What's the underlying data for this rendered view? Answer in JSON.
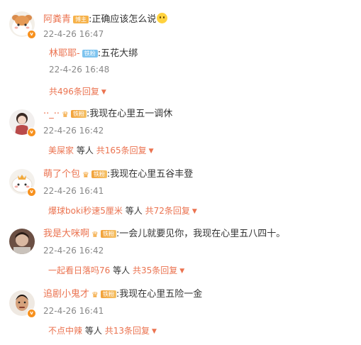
{
  "colors": {
    "username": "#eb7350",
    "time": "#888888",
    "text": "#333333",
    "badge_orange": "#f7911e",
    "tag_blue": "#7ec4ef"
  },
  "comments": [
    {
      "username": "阿粪青",
      "tag": "博主",
      "text": ":正确应该怎么说",
      "emoji": "smile-emoji",
      "time": "22-4-26 16:47",
      "reply": {
        "username": "林耶耶-",
        "tag": "铁粉",
        "text": ":五花大绑",
        "time": "22-4-26 16:48"
      },
      "reply_count": "共496条回复"
    },
    {
      "username": "··_··",
      "tag": "铁粉",
      "text": ":我现在心里五一调休",
      "time": "22-4-26 16:42",
      "reply_user": "美屎家",
      "reply_etc": "等人",
      "reply_count": "共165条回复"
    },
    {
      "username": "萌了个包",
      "tag": "铁粉",
      "text": ":我现在心里五谷丰登",
      "time": "22-4-26 16:41",
      "reply_user": "爆球boki秒速5厘米",
      "reply_etc": "等人",
      "reply_count": "共72条回复"
    },
    {
      "username": "我是大咪啊",
      "tag": "铁粉",
      "text": ":一会儿就要见你，我现在心里五八四十。",
      "time": "22-4-26 16:42",
      "reply_user": "一起看日落吗76",
      "reply_etc": "等人",
      "reply_count": "共35条回复"
    },
    {
      "username": "追剧小鬼才",
      "tag": "铁粉",
      "text": ":我现在心里五险一金",
      "time": "22-4-26 16:41",
      "reply_user": "不点中辣",
      "reply_etc": "等人",
      "reply_count": "共13条回复"
    }
  ]
}
